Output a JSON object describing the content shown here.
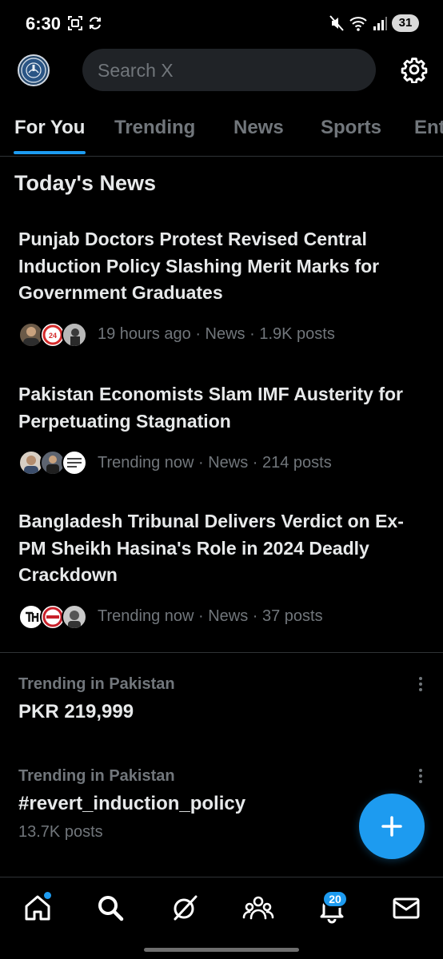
{
  "status_bar": {
    "time": "6:30",
    "battery": "31"
  },
  "header": {
    "search_placeholder": "Search X"
  },
  "tabs": [
    {
      "label": "For You",
      "active": true
    },
    {
      "label": "Trending",
      "active": false
    },
    {
      "label": "News",
      "active": false
    },
    {
      "label": "Sports",
      "active": false
    },
    {
      "label": "Entertainment",
      "active": false
    }
  ],
  "section": {
    "title": "Today's News"
  },
  "news": [
    {
      "headline": "Punjab Doctors Protest Revised Central Induction Policy Slashing Merit Marks for Government Graduates",
      "meta": "19 hours ago · News · 1.9K posts"
    },
    {
      "headline": "Pakistan Economists Slam IMF Austerity for Perpetuating Stagnation",
      "meta": "Trending now · News · 214 posts"
    },
    {
      "headline": "Bangladesh Tribunal Delivers Verdict on Ex-PM Sheikh Hasina's Role in 2024 Deadly Crackdown",
      "meta": "Trending now · News · 37 posts"
    }
  ],
  "trends": [
    {
      "context": "Trending in Pakistan",
      "name": "PKR 219,999",
      "posts": ""
    },
    {
      "context": "Trending in Pakistan",
      "name": "#revert_induction_policy",
      "posts": "13.7K posts"
    }
  ],
  "bottom_nav": {
    "items": [
      "home-icon",
      "search-icon",
      "grok-icon",
      "communities-icon",
      "notifications-icon",
      "messages-icon"
    ],
    "notifications_badge": "20"
  },
  "colors": {
    "background": "#000000",
    "accent": "#1d9bf0",
    "text_primary": "#e7e9ea",
    "text_secondary": "#71767b",
    "search_bg": "#202327"
  }
}
